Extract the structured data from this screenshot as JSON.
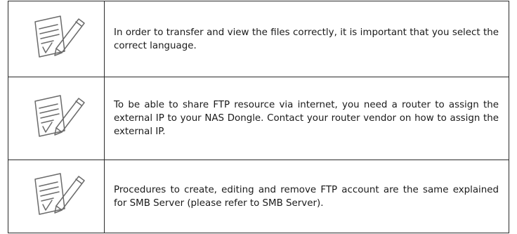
{
  "notes": [
    {
      "icon": "note-pencil-icon",
      "text": "In order to transfer and view the files correctly, it is important that you select the correct language."
    },
    {
      "icon": "note-pencil-icon",
      "text": "To be able to share FTP resource via internet, you need a router to assign the external IP to your NAS Dongle. Contact your router vendor on how to assign the external IP."
    },
    {
      "icon": "note-pencil-icon",
      "text": "Procedures to create, editing and remove FTP account are the same explained for SMB Server (please refer to SMB Server)."
    }
  ]
}
